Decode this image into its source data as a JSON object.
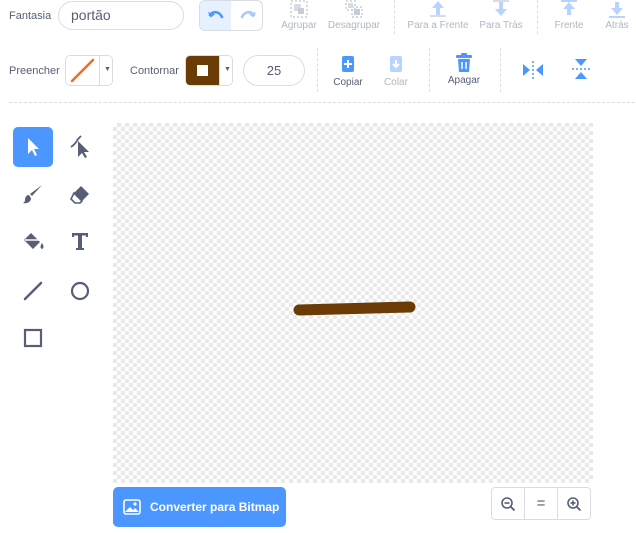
{
  "costume": {
    "label": "Fantasia",
    "name": "portão"
  },
  "toolbar_top": {
    "group": "Agrupar",
    "ungroup": "Desagrupar",
    "forward": "Para a Frente",
    "backward": "Para Trás",
    "front": "Frente",
    "back": "Atrás"
  },
  "toolbar_second": {
    "fill_label": "Preencher",
    "outline_label": "Contornar",
    "outline_color": "#6b3b05",
    "fill_color": "none",
    "outline_width": "25",
    "copy": "Copiar",
    "paste": "Colar",
    "delete": "Apagar"
  },
  "tools": [
    {
      "name": "select-tool",
      "icon": "arrow-icon",
      "selected": true
    },
    {
      "name": "reshape-tool",
      "icon": "reshape-icon",
      "selected": false
    },
    {
      "name": "brush-tool",
      "icon": "brush-icon",
      "selected": false
    },
    {
      "name": "eraser-tool",
      "icon": "eraser-icon",
      "selected": false
    },
    {
      "name": "fill-tool",
      "icon": "bucket-icon",
      "selected": false
    },
    {
      "name": "text-tool",
      "icon": "text-icon",
      "selected": false
    },
    {
      "name": "line-tool",
      "icon": "line-icon",
      "selected": false
    },
    {
      "name": "circle-tool",
      "icon": "circle-icon",
      "selected": false
    },
    {
      "name": "rectangle-tool",
      "icon": "rectangle-icon",
      "selected": false
    }
  ],
  "canvas": {
    "stroke_color": "#6b3b05"
  },
  "convert": {
    "label": "Converter para Bitmap"
  },
  "zoom": {
    "reset_symbol": "="
  },
  "colors": {
    "accent": "#4c97ff",
    "text": "#575e75",
    "disabled": "#b0b6c2"
  }
}
